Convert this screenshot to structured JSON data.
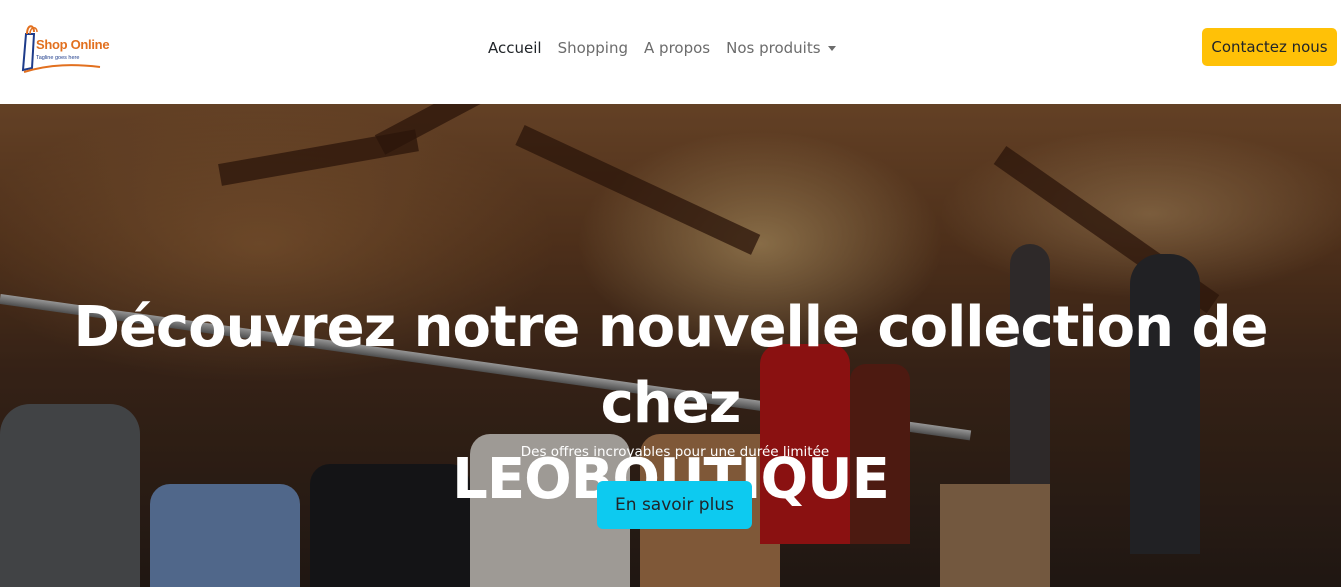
{
  "brand": {
    "name": "Shop Online",
    "tagline": "Tagline goes here",
    "icon": "shopping-bag-icon",
    "colors": {
      "name": "#e2701f",
      "tagline": "#1d3b8a"
    }
  },
  "nav": {
    "items": [
      {
        "label": "Accueil",
        "active": true
      },
      {
        "label": "Shopping",
        "active": false
      },
      {
        "label": "A propos",
        "active": false
      }
    ],
    "dropdown": {
      "label": "Nos produits",
      "icon": "caret-down-icon"
    }
  },
  "contact_button": {
    "label": "Contactez nous",
    "color": "#ffc107"
  },
  "hero": {
    "title_line1": "Découvrez notre nouvelle collection de chez",
    "title_line2": "LEOBOUTIQUE",
    "subtitle": "Des offres incroyables pour une durée limitée",
    "button_label": "En savoir plus",
    "button_color": "#0dcaf0",
    "background": "clothing-store-photo"
  }
}
